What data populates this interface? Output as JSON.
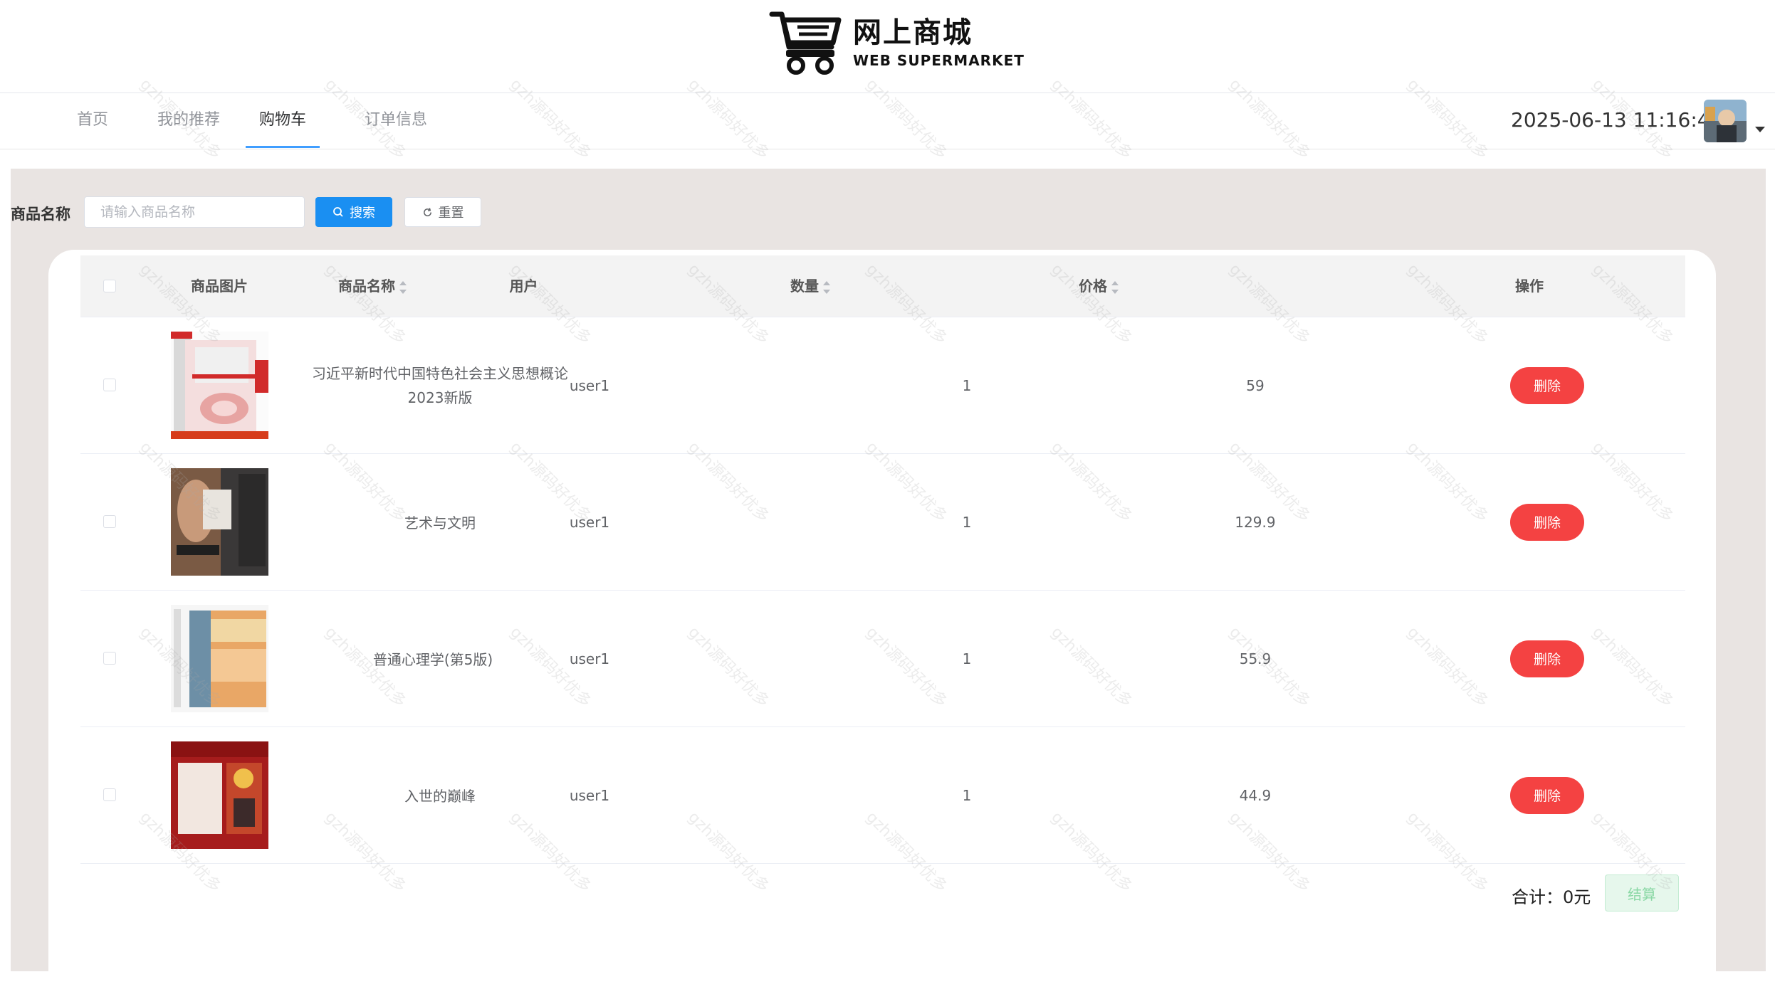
{
  "header": {
    "logo_cn": "网上商城",
    "logo_en": "WEB SUPERMARKET",
    "datetime": "2025-06-13 11:16:45"
  },
  "nav": {
    "items": [
      {
        "label": "首页",
        "active": false
      },
      {
        "label": "我的推荐",
        "active": false
      },
      {
        "label": "购物车",
        "active": true
      },
      {
        "label": "订单信息",
        "active": false
      }
    ]
  },
  "search": {
    "label": "商品名称",
    "placeholder": "请输入商品名称",
    "search_button": "搜索",
    "reset_button": "重置"
  },
  "table": {
    "headers": {
      "image": "商品图片",
      "name": "商品名称",
      "user": "用户",
      "count": "数量",
      "price": "价格",
      "action": "操作"
    },
    "rows": [
      {
        "name": "习近平新时代中国特色社会主义思想概论 2023新版",
        "user": "user1",
        "count": "1",
        "price": "59",
        "action": "删除"
      },
      {
        "name": "艺术与文明",
        "user": "user1",
        "count": "1",
        "price": "129.9",
        "action": "删除"
      },
      {
        "name": "普通心理学(第5版)",
        "user": "user1",
        "count": "1",
        "price": "55.9",
        "action": "删除"
      },
      {
        "name": "入世的巅峰",
        "user": "user1",
        "count": "1",
        "price": "44.9",
        "action": "删除"
      }
    ]
  },
  "footer": {
    "total": "合计：0元",
    "checkout_button": "结算"
  },
  "watermark": "gzh源码好优多",
  "colors": {
    "primary": "#409eff",
    "danger": "#f44242",
    "success_light": "#e6f7ec",
    "background": "#e9e4e2"
  }
}
